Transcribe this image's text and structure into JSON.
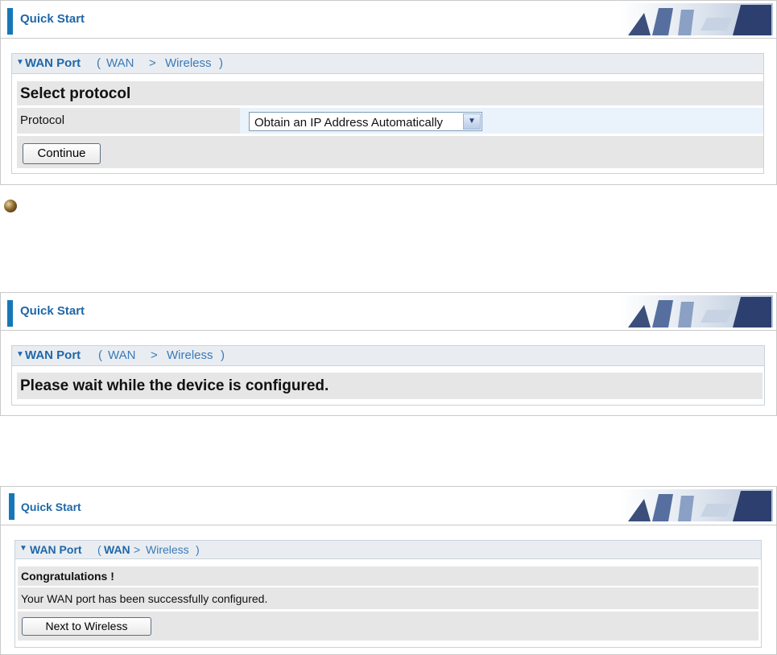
{
  "screens": [
    {
      "header_title": "Quick Start",
      "panel": {
        "name": "WAN Port",
        "crumb_wan": "WAN",
        "crumb_sep": ">",
        "crumb_next": "Wireless"
      },
      "section_title": "Select protocol",
      "protocol_label": "Protocol",
      "protocol_value": "Obtain an IP Address Automatically",
      "continue_label": "Continue"
    },
    {
      "header_title": "Quick Start",
      "panel": {
        "name": "WAN Port",
        "crumb_wan": "WAN",
        "crumb_sep": ">",
        "crumb_next": "Wireless"
      },
      "message": "Please wait while the device is configured."
    },
    {
      "header_title": "Quick Start",
      "panel": {
        "name": "WAN Port",
        "crumb_wan": "WAN",
        "crumb_sep": ">",
        "crumb_next": "Wireless"
      },
      "congrats": "Congratulations !",
      "success_text": "Your WAN port has been successfully configured.",
      "next_label": "Next to Wireless"
    }
  ],
  "icons": [
    "down-triangle-icon",
    "bullet-icon",
    "office-chairs-banner"
  ],
  "colors": {
    "accent": "#1677b8",
    "title": "#1f67a8",
    "row_bg": "#e6e6e6",
    "panel_head": "#e9edf1"
  }
}
